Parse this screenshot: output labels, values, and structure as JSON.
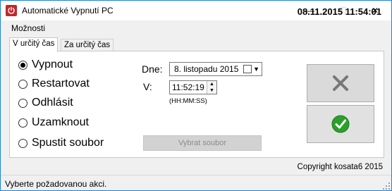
{
  "window": {
    "title": "Automatické Vypnutí PC",
    "minimize_glyph": "—",
    "maximize_glyph": "☐",
    "close_glyph": "✕"
  },
  "menu": {
    "items": [
      "Možnosti"
    ]
  },
  "clock": "08.11.2015 11:54:01",
  "tabs": [
    {
      "label": "V určitý čas",
      "active": true
    },
    {
      "label": "Za určitý čas",
      "active": false
    }
  ],
  "actions": {
    "options": [
      {
        "label": "Vypnout",
        "checked": true
      },
      {
        "label": "Restartovat",
        "checked": false
      },
      {
        "label": "Odhlásit",
        "checked": false
      },
      {
        "label": "Uzamknout",
        "checked": false
      },
      {
        "label": "Spustit soubor",
        "checked": false
      }
    ]
  },
  "schedule": {
    "day_label": "Dne:",
    "date_value": "8. listopadu 2015",
    "time_label": "V:",
    "time_value": "11:52:19",
    "time_hint": "(HH:MM:SS)",
    "pick_file_label": "Vybrat soubor"
  },
  "buttons": {
    "cancel_icon": "x-icon",
    "confirm_icon": "check-icon",
    "confirm_color": "#2aa02a",
    "cancel_color": "#7a7a7a"
  },
  "copyright": "Copyright kosata6 2015",
  "status": "Vyberte požadovanou akci."
}
